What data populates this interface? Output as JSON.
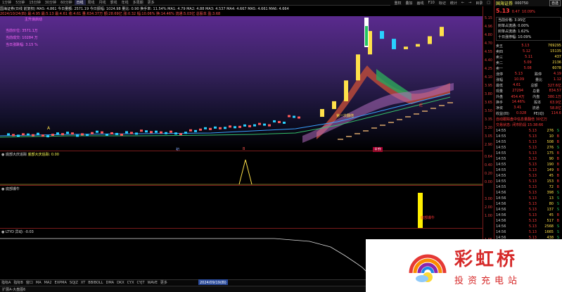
{
  "top_tabs": [
    "1分钟",
    "5分钟",
    "15分钟",
    "30分钟",
    "60分钟",
    "日线",
    "周线",
    "月线",
    "季线",
    "年线",
    "多周期",
    "更多"
  ],
  "active_tab": "日线",
  "top_tools": [
    "重权",
    "叠加",
    "画线",
    "F10",
    "标记",
    "统计",
    "←",
    "→",
    "目录",
    "□"
  ],
  "info_line1": "国海证券(日线 前复权)  MA5: 4.861  今日量额: 2571.19  今日振幅: 1024.98  量比: 0.90  换手率: 11.54%  MA1: 4.79  MA2: 4.88  MA3: 4.537  MA4: 4.667  MA5: 4.661  MA6: 4.664",
  "info_line2": "2024/10/24(四)  最:4.95  最:5.13  最:4.61  收:4.61  量:634.37万  额:28.69亿  涨:0.32  幅:10.06%  换:14.46%  流通:5.03亿  总股本  盈:3.68",
  "chart_overlay_texts": {
    "tag": "主升浪启动",
    "s1": "当前价位:  3571.1万",
    "s2": "当前成交:  10284 万",
    "s3": "当日涨跌幅:  3.15 %",
    "marker_a": "A",
    "label_one": "第一次翻倍",
    "label_dl": "赶",
    "date_marker1": "初",
    "date_marker2": "B",
    "date_marker3": "主升"
  },
  "chart_data": {
    "type": "line",
    "series": [
      {
        "values": [
          3.05,
          3.06,
          3.04,
          3.08,
          3.05,
          3.1,
          3.07,
          3.09,
          3.12,
          3.1,
          3.08,
          3.14,
          3.18,
          3.2,
          3.22,
          3.25,
          3.3,
          3.4,
          3.55,
          3.7,
          4.1,
          4.6,
          5.05,
          4.9,
          4.7,
          4.75,
          4.8,
          4.95,
          5.13
        ]
      }
    ]
  },
  "y_ticks": [
    "5.15",
    "4.96",
    "4.80",
    "4.70",
    "4.55",
    "4.40",
    "4.25",
    "4.10",
    "3.95",
    "3.80",
    "3.65",
    "3.50",
    "3.35",
    "3.20",
    "3.05",
    "2.90"
  ],
  "panel1": {
    "title": "底部大庆追踪",
    "subtitle": "底部大庆追踪: 0.00",
    "ticks": [
      "0.64",
      "0.40",
      "0.20",
      "0.00"
    ]
  },
  "panel2": {
    "title": "底部爆牛",
    "subtitle": "底部爆牛",
    "ticks": [
      "3.00",
      "2.00",
      "1.00"
    ]
  },
  "panel3": {
    "title": "LTYD",
    "subtitle": "异动: -0.03",
    "ticks": [
      "1.05",
      "0.80",
      "0.55",
      "0.30"
    ]
  },
  "bottom_tabs": [
    "指标A",
    "指标B",
    "窗口",
    "MA",
    "MA2",
    "EXPMA",
    "SQJZ",
    "XT",
    "BBIBOLL",
    "DMA",
    "DKX",
    "CYX",
    "CYJT",
    "WAVE",
    "更多"
  ],
  "status_text": "扩展A-大盘图6",
  "bottom_date": "2024/09/19(四)",
  "right_panel": {
    "title": "国海证券",
    "code": "000750",
    "price": "5.13",
    "change": "0.47",
    "pct": "10.09%",
    "tag": "自选",
    "news": [
      "当前价格: 3.95亿",
      "封单占流通: 0.00%",
      "封单占流通: 1.62%",
      "十日涨停幅: 10.09%"
    ],
    "order_book": [
      {
        "label": "卖五",
        "price": "5.13",
        "vol": "769295"
      },
      {
        "label": "卖四",
        "price": "5.12",
        "vol": "15135"
      },
      {
        "label": "卖三",
        "price": "5.11",
        "vol": "437"
      },
      {
        "label": "卖二",
        "price": "5.09",
        "vol": "2136"
      },
      {
        "label": "卖一",
        "price": "5.08",
        "vol": "6078"
      }
    ],
    "stats": [
      {
        "k": "涨停",
        "v": "5.13",
        "k2": "跌停",
        "v2": "4.19"
      },
      {
        "k": "涨幅",
        "v": "10.09",
        "k2": "量比",
        "v2": "1.12"
      },
      {
        "k": "最低",
        "v": "4.61",
        "k2": "总额",
        "v2": "327.6亿"
      },
      {
        "k": "现量",
        "v": "27294",
        "k2": "总量",
        "v2": "834.57"
      },
      {
        "k": "外盘",
        "v": "454.4万",
        "k2": "内盘",
        "v2": "380.1万"
      },
      {
        "k": "换手",
        "v": "14.46%",
        "k2": "股本",
        "v2": "63.9亿"
      },
      {
        "k": "净资",
        "v": "3.41",
        "k2": "流通",
        "v2": "58.8亿"
      },
      {
        "k": "收益(四)",
        "v": "0.028",
        "k2": "PE(动)",
        "v2": "114.6"
      }
    ],
    "notice1": "自动跟踪盘中信息量翻倍  30亿万",
    "notice2": "交易状态:  闭市阶段  15:38:66",
    "ticks": [
      {
        "t": "14:55",
        "p": "5.13",
        "v": "276",
        "f": "S"
      },
      {
        "t": "14:55",
        "p": "5.13",
        "v": "10",
        "f": "B"
      },
      {
        "t": "14:55",
        "p": "5.13",
        "v": "508",
        "f": "B"
      },
      {
        "t": "14:55",
        "p": "5.13",
        "v": "276",
        "f": "S"
      },
      {
        "t": "14:55",
        "p": "5.13",
        "v": "175",
        "f": "B"
      },
      {
        "t": "14:55",
        "p": "5.13",
        "v": "90",
        "f": "B"
      },
      {
        "t": "14:55",
        "p": "5.13",
        "v": "190",
        "f": "B"
      },
      {
        "t": "14:55",
        "p": "5.13",
        "v": "149",
        "f": "B"
      },
      {
        "t": "14:55",
        "p": "5.13",
        "v": "45",
        "f": "B"
      },
      {
        "t": "14:55",
        "p": "5.13",
        "v": "153",
        "f": "B"
      },
      {
        "t": "14:55",
        "p": "5.13",
        "v": "72",
        "f": "B"
      },
      {
        "t": "14:56",
        "p": "5.13",
        "v": "398",
        "f": "S"
      },
      {
        "t": "14:56",
        "p": "5.13",
        "v": "13",
        "f": "S"
      },
      {
        "t": "14:56",
        "p": "5.13",
        "v": "80",
        "f": "S"
      },
      {
        "t": "14:56",
        "p": "5.13",
        "v": "137",
        "f": "S"
      },
      {
        "t": "14:56",
        "p": "5.13",
        "v": "45",
        "f": "B"
      },
      {
        "t": "14:56",
        "p": "5.13",
        "v": "517",
        "f": "B"
      },
      {
        "t": "14:56",
        "p": "5.13",
        "v": "2568",
        "f": "S"
      },
      {
        "t": "14:56",
        "p": "5.13",
        "v": "1665",
        "f": "S"
      },
      {
        "t": "14:56",
        "p": "5.13",
        "v": "438",
        "f": "S"
      }
    ]
  },
  "logo": {
    "cn": "彩虹桥",
    "sub": "投资充电站"
  }
}
